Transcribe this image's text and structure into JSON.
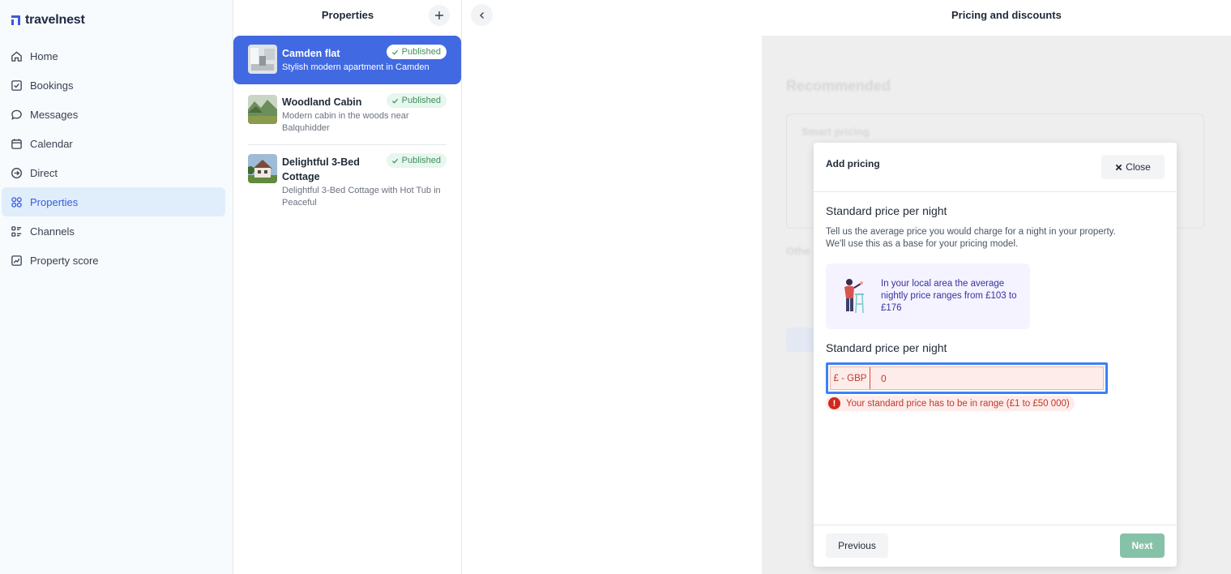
{
  "app": {
    "logo_text": "travelnest"
  },
  "sidebar": {
    "items": [
      {
        "label": "Home",
        "icon": "home-icon"
      },
      {
        "label": "Bookings",
        "icon": "bookings-icon"
      },
      {
        "label": "Messages",
        "icon": "messages-icon"
      },
      {
        "label": "Calendar",
        "icon": "calendar-icon"
      },
      {
        "label": "Direct",
        "icon": "direct-icon"
      },
      {
        "label": "Properties",
        "icon": "properties-icon",
        "active": true
      },
      {
        "label": "Channels",
        "icon": "channels-icon"
      },
      {
        "label": "Property score",
        "icon": "property-score-icon"
      }
    ]
  },
  "properties": {
    "title": "Properties",
    "add_icon": "plus-icon",
    "list": [
      {
        "name": "Camden flat",
        "description": "Stylish modern apartment in Camden",
        "status": "Published",
        "selected": true
      },
      {
        "name": "Woodland Cabin",
        "description": "Modern cabin in the woods near Balquhidder",
        "status": "Published"
      },
      {
        "name": "Delightful 3-Bed Cottage",
        "description": "Delightful 3-Bed Cottage with Hot Tub in Peaceful",
        "status": "Published"
      }
    ]
  },
  "main": {
    "title": "Pricing and discounts",
    "background": {
      "recommended": "Recommended",
      "smart_pricing": "Smart pricing",
      "other": "Othe"
    }
  },
  "modal": {
    "title": "Add pricing",
    "close_label": "Close",
    "heading": "Standard price per night",
    "help_line1": "Tell us the average price you would charge for a night in your property.",
    "help_line2": "We'll use this as a base for your pricing model.",
    "info_text": "In your local area the average nightly price ranges from £103 to £176",
    "field_label": "Standard price per night",
    "currency": "£ - GBP",
    "price_value": "0",
    "error": "Your standard price has to be in range (£1 to £50 000)",
    "prev_label": "Previous",
    "next_label": "Next"
  },
  "colors": {
    "primary": "#4169e1",
    "published_bg": "#e7f6ee",
    "published_text": "#3f8f5d",
    "error": "#c0392b",
    "next_button": "#86c2a8"
  }
}
